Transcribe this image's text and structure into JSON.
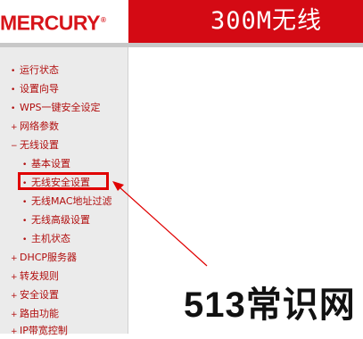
{
  "header": {
    "logo_text": "MERCURY",
    "logo_reg": "®",
    "banner_text": "300M无线"
  },
  "sidebar": {
    "items": [
      {
        "marker": "•",
        "label": "运行状态"
      },
      {
        "marker": "•",
        "label": "设置向导"
      },
      {
        "marker": "•",
        "label": "WPS一键安全设定"
      },
      {
        "marker": "+",
        "label": "网络参数"
      },
      {
        "marker": "−",
        "label": "无线设置"
      },
      {
        "marker": "•",
        "label": "基本设置"
      },
      {
        "marker": "•",
        "label": "无线安全设置"
      },
      {
        "marker": "•",
        "label": "无线MAC地址过滤"
      },
      {
        "marker": "•",
        "label": "无线高级设置"
      },
      {
        "marker": "•",
        "label": "主机状态"
      },
      {
        "marker": "+",
        "label": "DHCP服务器"
      },
      {
        "marker": "+",
        "label": "转发规则"
      },
      {
        "marker": "+",
        "label": "安全设置"
      },
      {
        "marker": "+",
        "label": "路由功能"
      },
      {
        "marker": "+",
        "label": "IP带宽控制"
      }
    ]
  },
  "watermark": {
    "text": "513常识网"
  },
  "colors": {
    "brand_red": "#d40a14",
    "menu_text": "#b10e0e",
    "sidebar_bg": "#ebebeb",
    "annotation_red": "#e00000"
  }
}
